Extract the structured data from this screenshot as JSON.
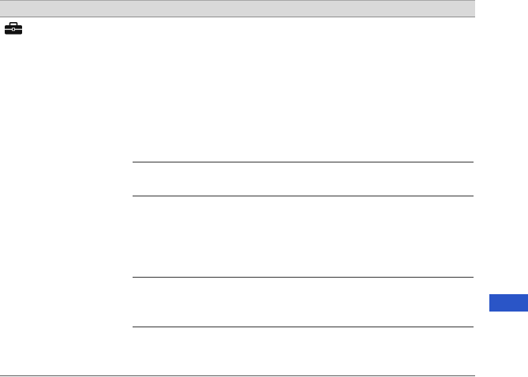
{
  "page": {
    "header_color": "#d9d9d9",
    "accent_color": "#2a55c7",
    "icon": "toolbox-icon"
  },
  "table": {
    "header_cells": [],
    "rows": []
  }
}
